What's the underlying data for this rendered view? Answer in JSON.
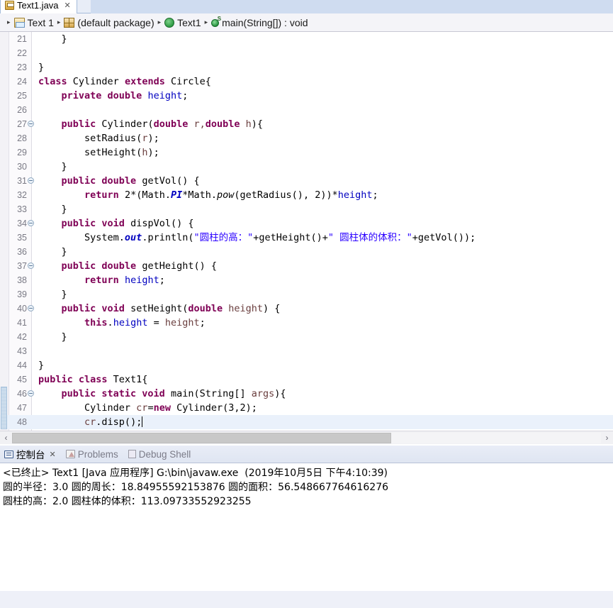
{
  "window": {
    "tab": {
      "title": "Text1.java",
      "close": "✕",
      "icon": "java-file-icon"
    }
  },
  "breadcrumb": {
    "separator": "▸",
    "items": [
      {
        "label": "Text 1",
        "icon": "project-icon"
      },
      {
        "label": "(default package)",
        "icon": "package-icon"
      },
      {
        "label": "Text1",
        "icon": "class-icon"
      },
      {
        "label": "main(String[]) : void",
        "icon": "method-static-icon"
      }
    ]
  },
  "editor": {
    "lines": [
      {
        "num": "21",
        "fold": false,
        "current": false,
        "changed": false,
        "tokens": [
          {
            "t": "    }",
            "c": "pln"
          }
        ]
      },
      {
        "num": "22",
        "fold": false,
        "current": false,
        "changed": false,
        "tokens": [
          {
            "t": "",
            "c": "pln"
          }
        ]
      },
      {
        "num": "23",
        "fold": false,
        "current": false,
        "changed": false,
        "tokens": [
          {
            "t": "}",
            "c": "pln"
          }
        ]
      },
      {
        "num": "24",
        "fold": false,
        "current": false,
        "changed": false,
        "tokens": [
          {
            "t": "class ",
            "c": "kw"
          },
          {
            "t": "Cylinder ",
            "c": "pln"
          },
          {
            "t": "extends ",
            "c": "kw"
          },
          {
            "t": "Circle{",
            "c": "pln"
          }
        ]
      },
      {
        "num": "25",
        "fold": false,
        "current": false,
        "changed": false,
        "tokens": [
          {
            "t": "    ",
            "c": "pln"
          },
          {
            "t": "private double ",
            "c": "kw"
          },
          {
            "t": "height",
            "c": "fld"
          },
          {
            "t": ";",
            "c": "pln"
          }
        ]
      },
      {
        "num": "26",
        "fold": false,
        "current": false,
        "changed": false,
        "tokens": [
          {
            "t": "",
            "c": "pln"
          }
        ]
      },
      {
        "num": "27",
        "fold": true,
        "current": false,
        "changed": false,
        "tokens": [
          {
            "t": "    ",
            "c": "pln"
          },
          {
            "t": "public ",
            "c": "kw"
          },
          {
            "t": "Cylinder(",
            "c": "pln"
          },
          {
            "t": "double ",
            "c": "kw"
          },
          {
            "t": "r,",
            "c": "par"
          },
          {
            "t": "double ",
            "c": "kw"
          },
          {
            "t": "h",
            "c": "par"
          },
          {
            "t": "){",
            "c": "pln"
          }
        ]
      },
      {
        "num": "28",
        "fold": false,
        "current": false,
        "changed": false,
        "tokens": [
          {
            "t": "        setRadius(",
            "c": "pln"
          },
          {
            "t": "r",
            "c": "par"
          },
          {
            "t": ");",
            "c": "pln"
          }
        ]
      },
      {
        "num": "29",
        "fold": false,
        "current": false,
        "changed": false,
        "tokens": [
          {
            "t": "        setHeight(",
            "c": "pln"
          },
          {
            "t": "h",
            "c": "par"
          },
          {
            "t": ");",
            "c": "pln"
          }
        ]
      },
      {
        "num": "30",
        "fold": false,
        "current": false,
        "changed": false,
        "tokens": [
          {
            "t": "    }",
            "c": "pln"
          }
        ]
      },
      {
        "num": "31",
        "fold": true,
        "current": false,
        "changed": false,
        "tokens": [
          {
            "t": "    ",
            "c": "pln"
          },
          {
            "t": "public double ",
            "c": "kw"
          },
          {
            "t": "getVol() {",
            "c": "pln"
          }
        ]
      },
      {
        "num": "32",
        "fold": false,
        "current": false,
        "changed": false,
        "tokens": [
          {
            "t": "        ",
            "c": "pln"
          },
          {
            "t": "return ",
            "c": "kw"
          },
          {
            "t": "2*(Math.",
            "c": "pln"
          },
          {
            "t": "PI",
            "c": "sfld"
          },
          {
            "t": "*Math.",
            "c": "pln"
          },
          {
            "t": "pow",
            "c": "smeth"
          },
          {
            "t": "(getRadius(), 2))*",
            "c": "pln"
          },
          {
            "t": "height",
            "c": "fld"
          },
          {
            "t": ";",
            "c": "pln"
          }
        ]
      },
      {
        "num": "33",
        "fold": false,
        "current": false,
        "changed": false,
        "tokens": [
          {
            "t": "    }",
            "c": "pln"
          }
        ]
      },
      {
        "num": "34",
        "fold": true,
        "current": false,
        "changed": false,
        "tokens": [
          {
            "t": "    ",
            "c": "pln"
          },
          {
            "t": "public void ",
            "c": "kw"
          },
          {
            "t": "dispVol() {",
            "c": "pln"
          }
        ]
      },
      {
        "num": "35",
        "fold": false,
        "current": false,
        "changed": false,
        "tokens": [
          {
            "t": "        System.",
            "c": "pln"
          },
          {
            "t": "out",
            "c": "sfld"
          },
          {
            "t": ".println(",
            "c": "pln"
          },
          {
            "t": "\"圆柱的高：\"",
            "c": "str"
          },
          {
            "t": "+getHeight()+",
            "c": "pln"
          },
          {
            "t": "\" 圆柱体的体积：\"",
            "c": "str"
          },
          {
            "t": "+getVol());",
            "c": "pln"
          }
        ]
      },
      {
        "num": "36",
        "fold": false,
        "current": false,
        "changed": false,
        "tokens": [
          {
            "t": "    }",
            "c": "pln"
          }
        ]
      },
      {
        "num": "37",
        "fold": true,
        "current": false,
        "changed": false,
        "tokens": [
          {
            "t": "    ",
            "c": "pln"
          },
          {
            "t": "public double ",
            "c": "kw"
          },
          {
            "t": "getHeight() {",
            "c": "pln"
          }
        ]
      },
      {
        "num": "38",
        "fold": false,
        "current": false,
        "changed": false,
        "tokens": [
          {
            "t": "        ",
            "c": "pln"
          },
          {
            "t": "return ",
            "c": "kw"
          },
          {
            "t": "height",
            "c": "fld"
          },
          {
            "t": ";",
            "c": "pln"
          }
        ]
      },
      {
        "num": "39",
        "fold": false,
        "current": false,
        "changed": false,
        "tokens": [
          {
            "t": "    }",
            "c": "pln"
          }
        ]
      },
      {
        "num": "40",
        "fold": true,
        "current": false,
        "changed": false,
        "tokens": [
          {
            "t": "    ",
            "c": "pln"
          },
          {
            "t": "public void ",
            "c": "kw"
          },
          {
            "t": "setHeight(",
            "c": "pln"
          },
          {
            "t": "double ",
            "c": "kw"
          },
          {
            "t": "height",
            "c": "par"
          },
          {
            "t": ") {",
            "c": "pln"
          }
        ]
      },
      {
        "num": "41",
        "fold": false,
        "current": false,
        "changed": false,
        "tokens": [
          {
            "t": "        ",
            "c": "pln"
          },
          {
            "t": "this",
            "c": "kw"
          },
          {
            "t": ".",
            "c": "pln"
          },
          {
            "t": "height",
            "c": "fld"
          },
          {
            "t": " = ",
            "c": "pln"
          },
          {
            "t": "height",
            "c": "par"
          },
          {
            "t": ";",
            "c": "pln"
          }
        ]
      },
      {
        "num": "42",
        "fold": false,
        "current": false,
        "changed": false,
        "tokens": [
          {
            "t": "    }",
            "c": "pln"
          }
        ]
      },
      {
        "num": "43",
        "fold": false,
        "current": false,
        "changed": false,
        "tokens": [
          {
            "t": "",
            "c": "pln"
          }
        ]
      },
      {
        "num": "44",
        "fold": false,
        "current": false,
        "changed": false,
        "tokens": [
          {
            "t": "}",
            "c": "pln"
          }
        ]
      },
      {
        "num": "45",
        "fold": false,
        "current": false,
        "changed": false,
        "tokens": [
          {
            "t": "public class ",
            "c": "kw"
          },
          {
            "t": "Text1{",
            "c": "pln"
          }
        ]
      },
      {
        "num": "46",
        "fold": true,
        "current": false,
        "changed": true,
        "tokens": [
          {
            "t": "    ",
            "c": "pln"
          },
          {
            "t": "public static void ",
            "c": "kw"
          },
          {
            "t": "main(String[] ",
            "c": "pln"
          },
          {
            "t": "args",
            "c": "par"
          },
          {
            "t": "){",
            "c": "pln"
          }
        ]
      },
      {
        "num": "47",
        "fold": false,
        "current": false,
        "changed": true,
        "tokens": [
          {
            "t": "        Cylinder ",
            "c": "pln"
          },
          {
            "t": "cr",
            "c": "par"
          },
          {
            "t": "=",
            "c": "pln"
          },
          {
            "t": "new ",
            "c": "kw"
          },
          {
            "t": "Cylinder(3,2);",
            "c": "pln"
          }
        ]
      },
      {
        "num": "48",
        "fold": false,
        "current": true,
        "changed": true,
        "tokens": [
          {
            "t": "        ",
            "c": "pln"
          },
          {
            "t": "cr",
            "c": "par"
          },
          {
            "t": ".disp();",
            "c": "pln"
          }
        ],
        "caret": true
      }
    ]
  },
  "hscrollbar": {
    "left_arrow": "‹",
    "right_arrow": "›"
  },
  "console": {
    "tabs": [
      {
        "label": "控制台",
        "icon": "console-icon",
        "active": true,
        "close": "✕"
      },
      {
        "label": "Problems",
        "icon": "problems-icon",
        "active": false
      },
      {
        "label": "Debug Shell",
        "icon": "debug-shell-icon",
        "active": false
      }
    ],
    "header": "<已终止> Text1 [Java 应用程序] G:\\bin\\javaw.exe  (2019年10月5日 下午4:10:39)",
    "output": [
      "圆的半径：3.0 圆的周长：18.84955592153876 圆的面积：56.548667764616276",
      "圆柱的高：2.0 圆柱体的体积：113.09733552923255"
    ]
  },
  "colors": {
    "keyword": "#7f0055",
    "string": "#2a00ff",
    "field": "#0000c0",
    "parameter": "#6a3e3e",
    "current_line": "#eaf1fb"
  }
}
